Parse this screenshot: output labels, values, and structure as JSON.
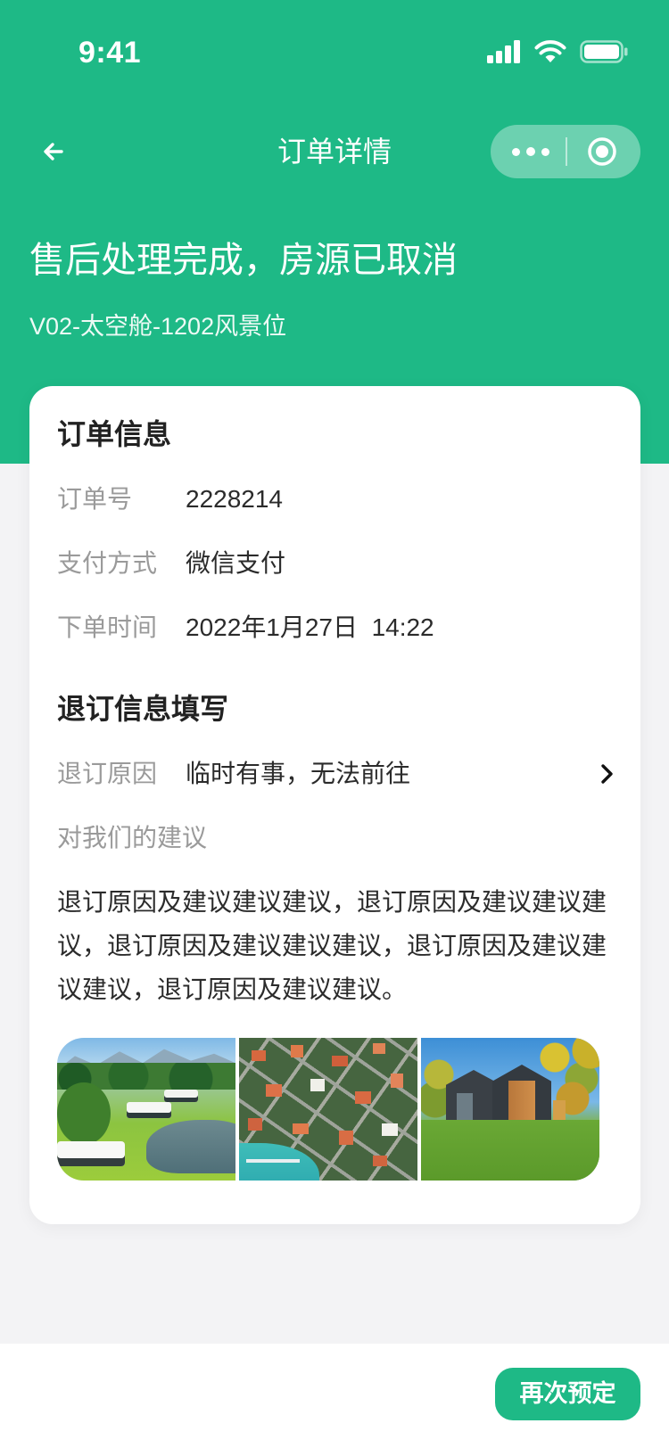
{
  "theme": {
    "accent": "#1eb986",
    "page_bg": "#f3f3f5"
  },
  "status_bar": {
    "time": "9:41",
    "icons": [
      "cellular-signal-icon",
      "wifi-icon",
      "battery-icon"
    ]
  },
  "nav": {
    "title": "订单详情",
    "back_icon": "back-arrow-icon",
    "more_icon": "more-dots-icon",
    "close_icon": "target-circle-icon"
  },
  "header": {
    "status": "售后处理完成，房源已取消",
    "room": "V02-太空舱-1202风景位"
  },
  "order_info": {
    "title": "订单信息",
    "rows": [
      {
        "label": "订单号",
        "value": "2228214"
      },
      {
        "label": "支付方式",
        "value": "微信支付"
      },
      {
        "label": "下单时间",
        "value": "2022年1月27日  14:22"
      }
    ]
  },
  "refund": {
    "title": "退订信息填写",
    "reason_label": "退订原因",
    "reason_value": "临时有事，无法前往",
    "suggestion_label": "对我们的建议",
    "suggestion_text": "退订原因及建议建议建议，退订原因及建议建议建议，退订原因及建议建议建议，退订原因及建议建议建议，退订原因及建议建议。",
    "photos": [
      "resort-cabins-photo",
      "aerial-town-photo",
      "modern-house-photo"
    ]
  },
  "footer": {
    "rebook_button": "再次预定"
  }
}
